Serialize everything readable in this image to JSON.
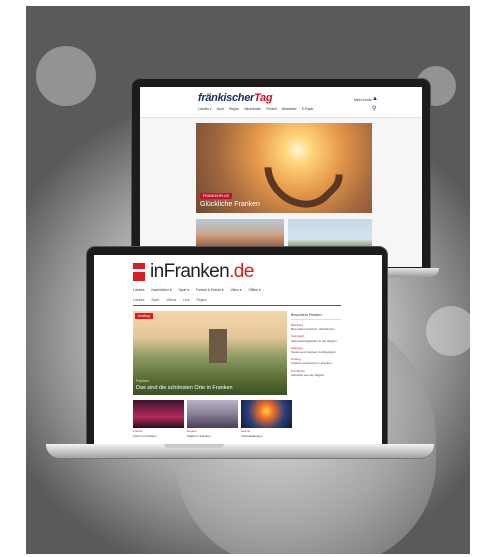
{
  "back_site": {
    "logo_text": "fränkischer",
    "logo_accent": "Tag",
    "nav": [
      "Lokales ▾",
      "Sport",
      "Region",
      "Nachrichten",
      "Freizeit",
      "Newsletter",
      "E-Paper"
    ],
    "user_label": "Mein Konto",
    "hero_badge": "FRANKENPLUS",
    "hero_title": "Glückliche Franken"
  },
  "front_site": {
    "logo_text": "inFranken",
    "logo_suffix": ".de",
    "nav": [
      "Lokales",
      "Nachrichten ▾",
      "Sport ▾",
      "Freizeit & Events ▾",
      "Video ▾",
      "Offline ▾"
    ],
    "subnav": [
      "Lokales",
      "Sport",
      "Videos",
      "Link",
      "Region"
    ],
    "hero_badge": "Ausflug",
    "hero_kicker": "Franken",
    "hero_title": "Das sind die schönsten Orte in Franken",
    "sidebar_heading": "Besonders Franken",
    "sidebar_items": [
      {
        "tag": "Bamberg",
        "text": "Besonders Franken: Attraktionen"
      },
      {
        "tag": "Kulmbach",
        "text": "Sehenswürdigkeiten in der Region"
      },
      {
        "tag": "Erlangen",
        "text": "Neues aus Franken Ausflugstipps"
      },
      {
        "tag": "Coburg",
        "text": "Freizeit und Events in Franken"
      },
      {
        "tag": "Forchheim",
        "text": "Aktuelles aus der Region"
      }
    ],
    "cards": [
      {
        "tag": "Freizeit",
        "text": "Feiern in Franken"
      },
      {
        "tag": "Region",
        "text": "Städte in Franken"
      },
      {
        "tag": "Events",
        "text": "Veranstaltungen"
      }
    ]
  }
}
